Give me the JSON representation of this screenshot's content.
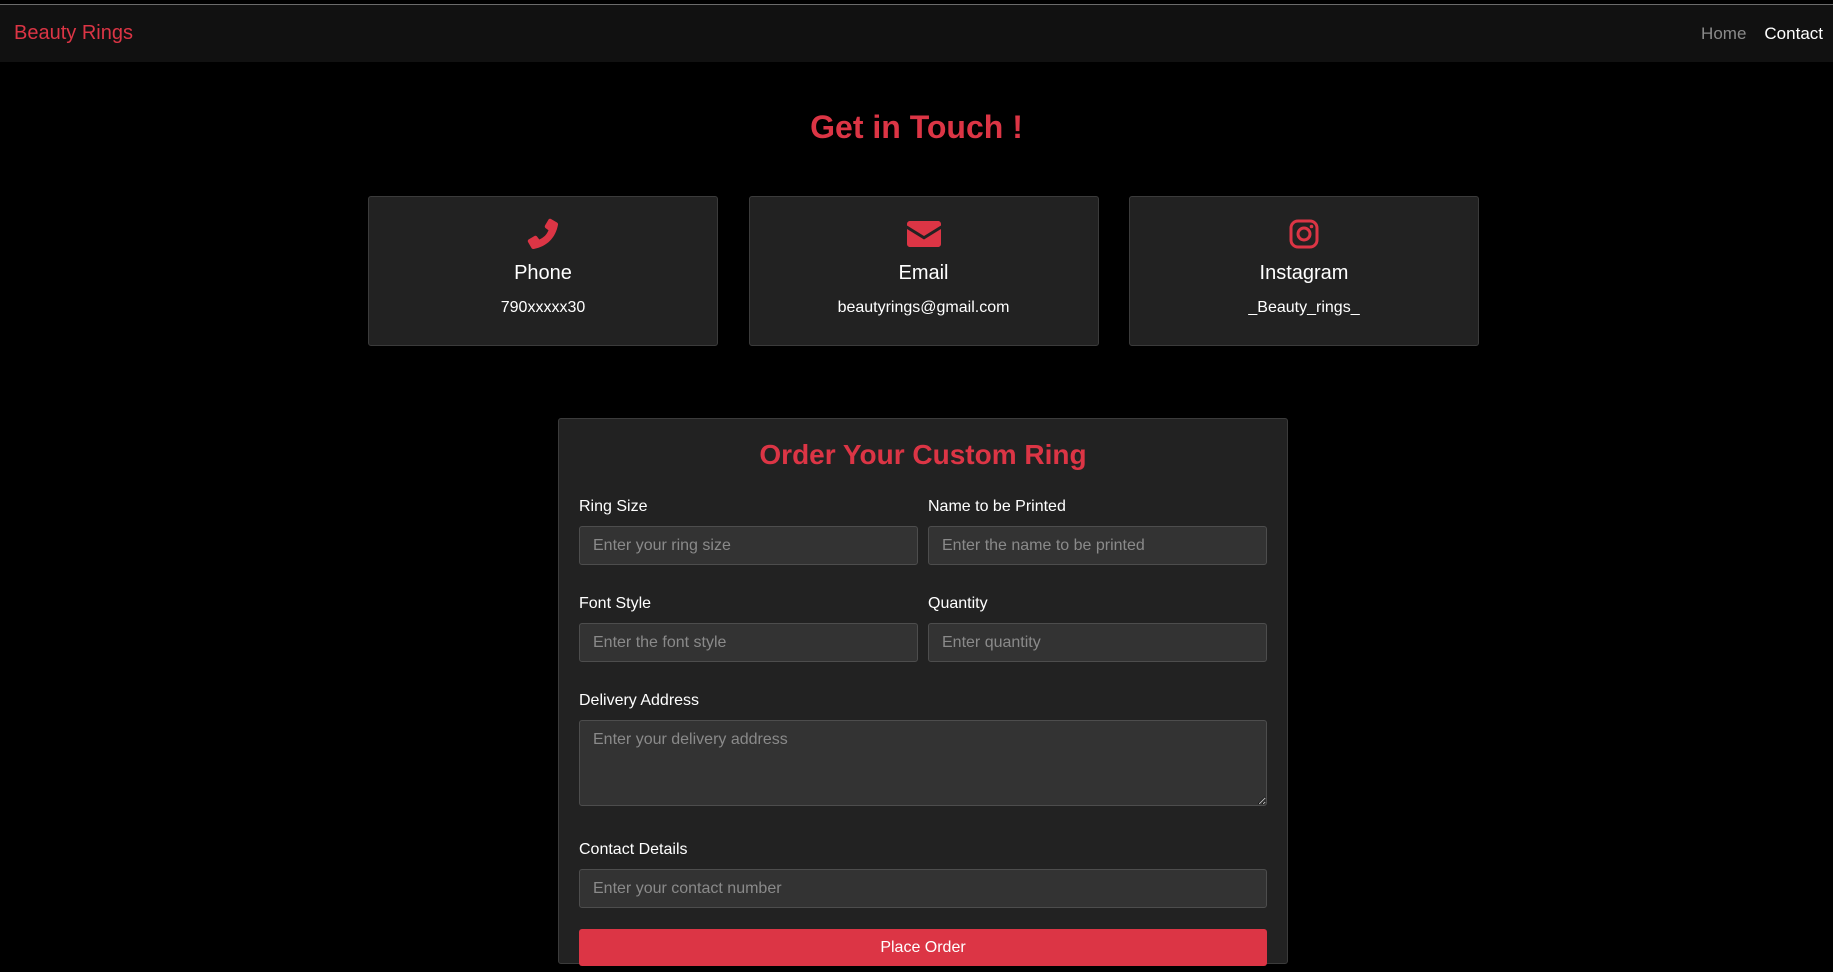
{
  "colors": {
    "accent": "#dc3545",
    "background": "#000000",
    "navbar": "#111111",
    "card": "#222222",
    "input": "#333333"
  },
  "navbar": {
    "brand": "Beauty Rings",
    "links": [
      {
        "label": "Home",
        "active": false
      },
      {
        "label": "Contact",
        "active": true
      }
    ]
  },
  "contact_section": {
    "title": "Get in Touch !",
    "cards": [
      {
        "icon": "phone-icon",
        "title": "Phone",
        "value": "790xxxxx30"
      },
      {
        "icon": "envelope-icon",
        "title": "Email",
        "value": "beautyrings@gmail.com"
      },
      {
        "icon": "instagram-icon",
        "title": "Instagram",
        "value": "_Beauty_rings_"
      }
    ]
  },
  "order_form": {
    "title": "Order Your Custom Ring",
    "ring_size": {
      "label": "Ring Size",
      "placeholder": "Enter your ring size"
    },
    "name_printed": {
      "label": "Name to be Printed",
      "placeholder": "Enter the name to be printed"
    },
    "font_style": {
      "label": "Font Style",
      "placeholder": "Enter the font style"
    },
    "quantity": {
      "label": "Quantity",
      "placeholder": "Enter quantity"
    },
    "delivery_address": {
      "label": "Delivery Address",
      "placeholder": "Enter your delivery address"
    },
    "contact_details": {
      "label": "Contact Details",
      "placeholder": "Enter your contact number"
    },
    "submit_label": "Place Order"
  }
}
